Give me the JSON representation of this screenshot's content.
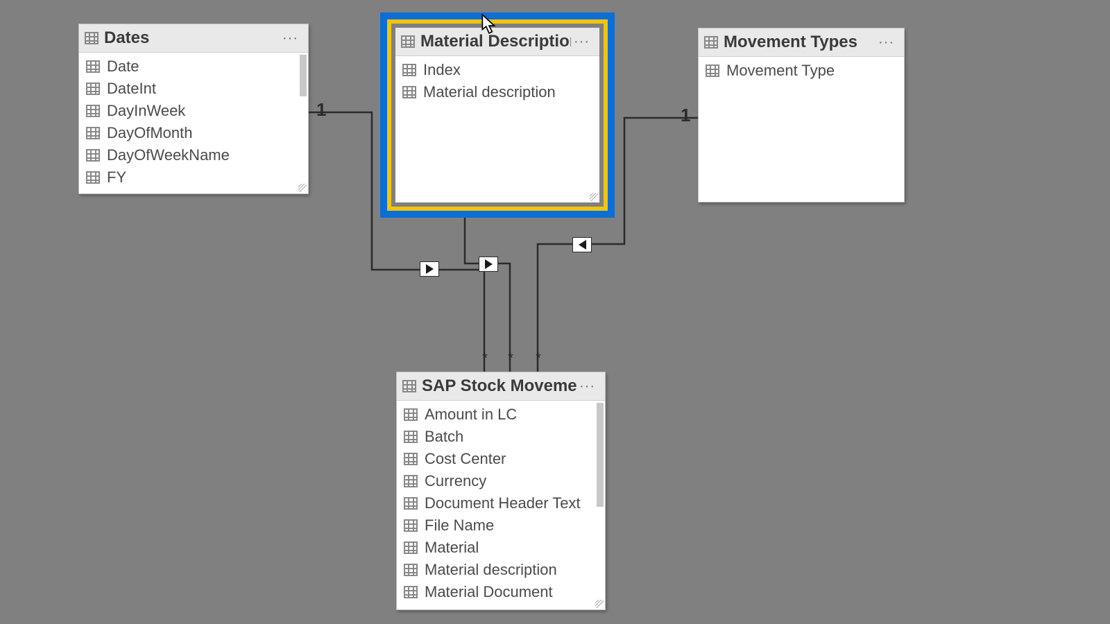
{
  "tables": {
    "dates": {
      "title": "Dates",
      "fields": [
        "Date",
        "DateInt",
        "DayInWeek",
        "DayOfMonth",
        "DayOfWeekName",
        "FY"
      ]
    },
    "materialDescription": {
      "title": "Material Description",
      "fields": [
        "Index",
        "Material description"
      ]
    },
    "movementTypes": {
      "title": "Movement Types",
      "fields": [
        "Movement Type"
      ]
    },
    "sapStockMovements": {
      "title": "SAP Stock Movements",
      "fields": [
        "Amount in LC",
        "Batch",
        "Cost Center",
        "Currency",
        "Document Header Text",
        "File Name",
        "Material",
        "Material description",
        "Material Document"
      ]
    }
  },
  "cardinality": {
    "dates_side": "1",
    "movementTypes_side": "1",
    "many": "*"
  },
  "menu_dots": "···"
}
